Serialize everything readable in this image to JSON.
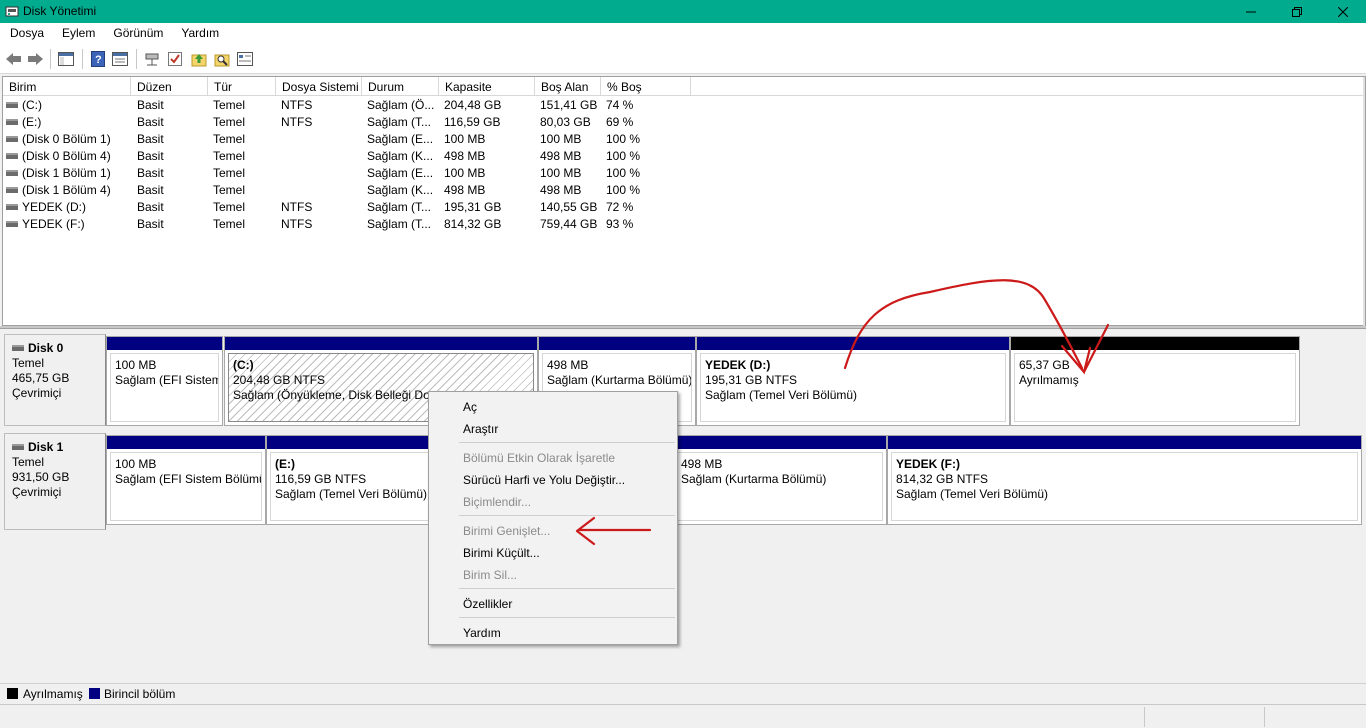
{
  "window": {
    "title": "Disk Yönetimi",
    "minimize_icon": "minimize-icon",
    "maximize_icon": "restore-icon",
    "close_icon": "close-icon"
  },
  "menu": [
    "Dosya",
    "Eylem",
    "Görünüm",
    "Yardım"
  ],
  "toolbar": {
    "icons": [
      "back-arrow-icon",
      "forward-arrow-icon",
      "show-hide-console-tree-icon",
      "help-icon",
      "properties-icon",
      "connect-virtual-disk-icon",
      "check-icon",
      "up-folder-icon",
      "search-folder-icon",
      "settings-panel-icon"
    ]
  },
  "volume_list": {
    "columns": [
      "Birim",
      "Düzen",
      "Tür",
      "Dosya Sistemi",
      "Durum",
      "Kapasite",
      "Boş Alan",
      "% Boş"
    ],
    "rows": [
      {
        "birim": "(C:)",
        "duzen": "Basit",
        "tur": "Temel",
        "fs": "NTFS",
        "durum": "Sağlam (Ö...",
        "kapasite": "204,48 GB",
        "bos": "151,41 GB",
        "yuzde": "74 %"
      },
      {
        "birim": "(E:)",
        "duzen": "Basit",
        "tur": "Temel",
        "fs": "NTFS",
        "durum": "Sağlam (T...",
        "kapasite": "116,59 GB",
        "bos": "80,03 GB",
        "yuzde": "69 %"
      },
      {
        "birim": "(Disk 0 Bölüm 1)",
        "duzen": "Basit",
        "tur": "Temel",
        "fs": "",
        "durum": "Sağlam (E...",
        "kapasite": "100 MB",
        "bos": "100 MB",
        "yuzde": "100 %"
      },
      {
        "birim": "(Disk 0 Bölüm 4)",
        "duzen": "Basit",
        "tur": "Temel",
        "fs": "",
        "durum": "Sağlam (K...",
        "kapasite": "498 MB",
        "bos": "498 MB",
        "yuzde": "100 %"
      },
      {
        "birim": "(Disk 1 Bölüm 1)",
        "duzen": "Basit",
        "tur": "Temel",
        "fs": "",
        "durum": "Sağlam (E...",
        "kapasite": "100 MB",
        "bos": "100 MB",
        "yuzde": "100 %"
      },
      {
        "birim": "(Disk 1 Bölüm 4)",
        "duzen": "Basit",
        "tur": "Temel",
        "fs": "",
        "durum": "Sağlam (K...",
        "kapasite": "498 MB",
        "bos": "498 MB",
        "yuzde": "100 %"
      },
      {
        "birim": "YEDEK (D:)",
        "duzen": "Basit",
        "tur": "Temel",
        "fs": "NTFS",
        "durum": "Sağlam (T...",
        "kapasite": "195,31 GB",
        "bos": "140,55 GB",
        "yuzde": "72 %"
      },
      {
        "birim": "YEDEK (F:)",
        "duzen": "Basit",
        "tur": "Temel",
        "fs": "NTFS",
        "durum": "Sağlam (T...",
        "kapasite": "814,32 GB",
        "bos": "759,44 GB",
        "yuzde": "93 %"
      }
    ]
  },
  "disks": [
    {
      "name": "Disk 0",
      "type": "Temel",
      "size": "465,75 GB",
      "status": "Çevrimiçi",
      "partitions": [
        {
          "name": "",
          "size": "100 MB",
          "status": "Sağlam (EFI Sistem"
        },
        {
          "name": "(C:)",
          "size": "204,48 GB NTFS",
          "status": "Sağlam (Önyükleme, Disk Belleği Dos"
        },
        {
          "name": "",
          "size": "498 MB",
          "status": "Sağlam (Kurtarma Bölümü)"
        },
        {
          "name": "YEDEK  (D:)",
          "size": "195,31 GB NTFS",
          "status": "Sağlam (Temel Veri Bölümü)"
        },
        {
          "name": "",
          "size": "65,37 GB",
          "status": "Ayrılmamış"
        }
      ]
    },
    {
      "name": "Disk 1",
      "type": "Temel",
      "size": "931,50 GB",
      "status": "Çevrimiçi",
      "partitions": [
        {
          "name": "",
          "size": "100 MB",
          "status": "Sağlam (EFI Sistem Bölümü"
        },
        {
          "name": "(E:)",
          "size": "116,59 GB NTFS",
          "status": "Sağlam (Temel Veri Bölümü)"
        },
        {
          "name": "",
          "size": "498 MB",
          "status": "Sağlam (Kurtarma Bölümü)"
        },
        {
          "name": "YEDEK  (F:)",
          "size": "814,32 GB NTFS",
          "status": "Sağlam (Temel Veri Bölümü)"
        }
      ]
    }
  ],
  "legend": [
    {
      "label": "Ayrılmamış",
      "color": "#000000"
    },
    {
      "label": "Birincil bölüm",
      "color": "#000080"
    }
  ],
  "context_menu": {
    "items": [
      {
        "label": "Aç",
        "enabled": true
      },
      {
        "label": "Araştır",
        "enabled": true
      },
      {
        "label": "Bölümü Etkin Olarak İşaretle",
        "enabled": false
      },
      {
        "label": "Sürücü Harfi ve Yolu Değiştir...",
        "enabled": true
      },
      {
        "label": "Biçimlendir...",
        "enabled": false
      },
      {
        "label": "Birimi Genişlet...",
        "enabled": false
      },
      {
        "label": "Birimi Küçült...",
        "enabled": true
      },
      {
        "label": "Birim Sil...",
        "enabled": false
      },
      {
        "label": "Özellikler",
        "enabled": true
      },
      {
        "label": "Yardım",
        "enabled": true
      }
    ]
  },
  "colors": {
    "titlebar": "#00ab8e",
    "primary_partition": "#000080",
    "unallocated": "#000000",
    "annotation": "#cc1a1a"
  }
}
